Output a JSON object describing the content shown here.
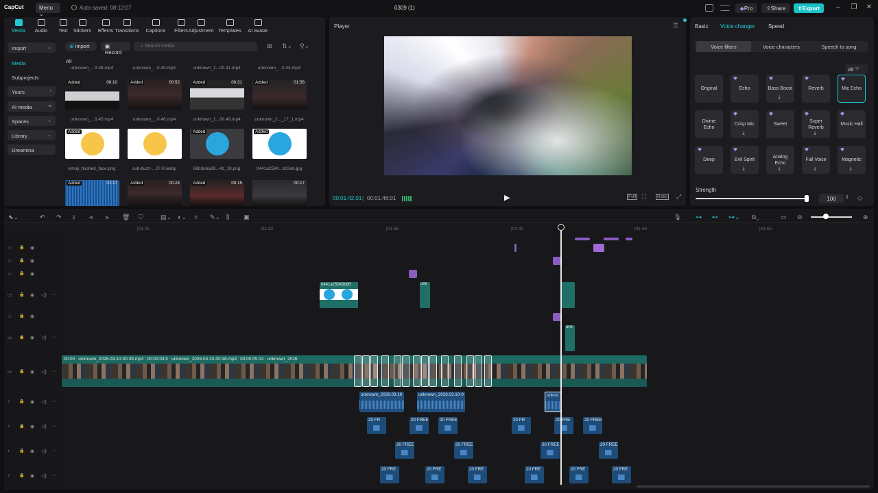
{
  "titlebar": {
    "app_name": "CapCut",
    "menu_label": "Menu",
    "autosave_text": "Auto saved: 08:12:07",
    "project_title": "0309 (1)",
    "pro_label": "Pro",
    "share_label": "Share",
    "export_label": "Export"
  },
  "media_toolbar": [
    {
      "label": "Media",
      "active": true
    },
    {
      "label": "Audio"
    },
    {
      "label": "Text"
    },
    {
      "label": "Stickers"
    },
    {
      "label": "Effects"
    },
    {
      "label": "Transitions"
    },
    {
      "label": "Captions"
    },
    {
      "label": "Filters"
    },
    {
      "label": "Adjustment"
    },
    {
      "label": "Templates"
    },
    {
      "label": "AI avatar"
    }
  ],
  "media_sidebar": [
    {
      "label": "Import"
    },
    {
      "label": "Media"
    },
    {
      "label": "Subprojects"
    },
    {
      "label": "Yours"
    },
    {
      "label": "AI media"
    },
    {
      "label": "Spaces"
    },
    {
      "label": "Library"
    },
    {
      "label": "Dreamina"
    }
  ],
  "media": {
    "import_label": "Import",
    "record_label": "Record",
    "search_placeholder": "Search media",
    "filter_label": "All",
    "top_names": [
      "unknown_...0.38.mp4",
      "unknown_...0.40.mp4",
      "unknown_2...00.41.mp4",
      "unknown_...0.44.mp4"
    ],
    "rows": [
      [
        {
          "added": "Added",
          "dur": "00:10",
          "name": "unknown_...0.45.mp4"
        },
        {
          "added": "Added",
          "dur": "00:52",
          "name": "unknown_...0.46.mp4"
        },
        {
          "added": "Added",
          "dur": "00:31",
          "name": "unknown_2...00.49.mp4"
        },
        {
          "added": "Added",
          "dur": "01:56",
          "name": "unknown_2..._17_1.mp4"
        }
      ],
      [
        {
          "added": "Added",
          "dur": "",
          "name": "emoji_flushed_face.png"
        },
        {
          "added": "",
          "dur": "",
          "name": "sub-buzz-...27-8.webp"
        },
        {
          "added": "Added",
          "dur": "",
          "name": "66b3eba28...4d_18.png"
        },
        {
          "added": "Added",
          "dur": "",
          "name": "0441a2594...b02eb.jpg"
        }
      ],
      [
        {
          "added": "Added",
          "dur": "01:17",
          "name": ""
        },
        {
          "added": "Added",
          "dur": "00:24",
          "name": ""
        },
        {
          "added": "Added",
          "dur": "00:15",
          "name": ""
        },
        {
          "added": "",
          "dur": "00:17",
          "name": ""
        }
      ]
    ]
  },
  "player": {
    "title": "Player",
    "current_time": "00:01:42:01",
    "total_time": "00:01:46:01",
    "full_label": "Full",
    "ratio_label": "Ratio"
  },
  "props": {
    "tabs": [
      "Basic",
      "Voice changer",
      "Speed"
    ],
    "active_tab": "Voice changer",
    "subtabs": [
      "Voice filters",
      "Voice characters",
      "Speech to song"
    ],
    "all_label": "All",
    "voices": [
      [
        "Original",
        "Echo",
        "Bass Boost",
        "Reverb",
        "Mic Echo"
      ],
      [
        "Divine Echo",
        "Crisp Mic",
        "Sweet",
        "Super Reverb",
        "Music Hall"
      ],
      [
        "Deep",
        "Evil Spirit",
        "Analog Echo",
        "Full Voice",
        "Magnetic"
      ]
    ],
    "selected_voice": "Mic Echo",
    "strength_label": "Strength",
    "strength_value": "100",
    "strength_fraction": 0.99
  },
  "timeline": {
    "ruler": [
      "|01:25",
      "|01:30",
      "|01:35",
      "|01:40",
      "|01:45",
      "|01:50"
    ],
    "main_clip_labels": [
      {
        "text": "00:00",
        "time": ""
      },
      {
        "text": "unknown_2026.03.10-00.38.mp4",
        "time": "00:00:04:0"
      },
      {
        "text": "unknown_2026.03.10-00.38.mp4",
        "time": "00:00:05:12"
      },
      {
        "text": "unknown_2026",
        "time": ""
      }
    ],
    "overlay_clip_label": "0441a25943b8ff",
    "audio_clips": [
      "unknown_2026.03.10",
      "unknown_2026.03.10-0",
      "unkno"
    ],
    "sfx_rows": [
      [
        "20 FR",
        "20 FREE",
        "20 FREE",
        "20 FR",
        "20 FRE",
        "20 FREE"
      ],
      [
        "20 FREE C",
        "20 FREE",
        "20 FREE C",
        "20 FREE C"
      ],
      [
        "20 FRE",
        "20 FRE",
        "20 FRE",
        "20 FRE",
        "20 FRE",
        "20 FRE"
      ]
    ]
  }
}
